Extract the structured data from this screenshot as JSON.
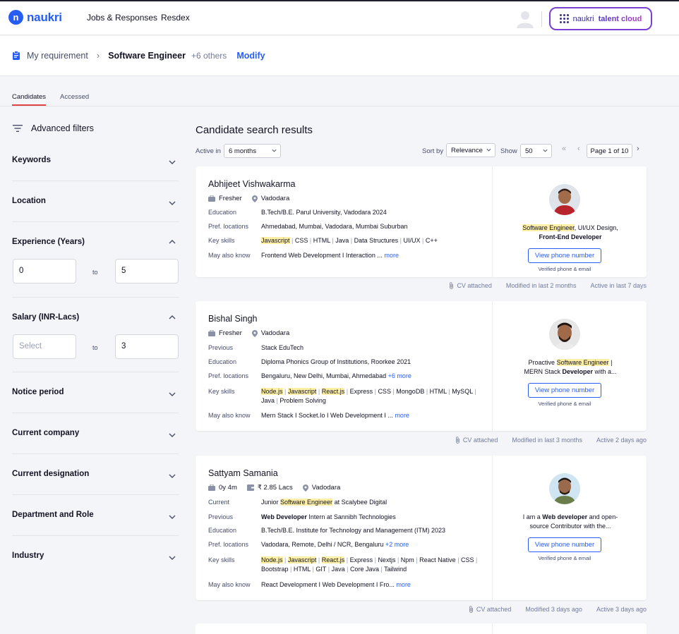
{
  "header": {
    "logo_text": "naukri",
    "nav": [
      "Jobs & Responses",
      "Resdex"
    ],
    "talent_cloud": {
      "prefix": "naukri",
      "brand": "talent cloud"
    }
  },
  "requirement": {
    "label": "My requirement",
    "title": "Software Engineer",
    "others": "+6 others",
    "modify": "Modify"
  },
  "tabs": [
    "Candidates",
    "Accessed"
  ],
  "filters": {
    "title": "Advanced filters",
    "sections": [
      "Keywords",
      "Location",
      "Experience (Years)",
      "Salary (INR-Lacs)",
      "Notice period",
      "Current company",
      "Current designation",
      "Department and Role",
      "Industry"
    ],
    "experience": {
      "min": "0",
      "to": "to",
      "max": "5"
    },
    "salary": {
      "min_placeholder": "Select",
      "to": "to",
      "max": "3"
    }
  },
  "results": {
    "title": "Candidate search results",
    "active_in_label": "Active in",
    "active_in_value": "6 months",
    "sort_by_label": "Sort by",
    "sort_by_value": "Relevance",
    "show_label": "Show",
    "show_value": "50",
    "page": "Page 1 of 10"
  },
  "candidates": [
    {
      "name": "Abhijeet Vishwakarma",
      "experience": "Fresher",
      "location": "Vadodara",
      "education_label": "Education",
      "education": "B.Tech/B.E. Parul University, Vadodara 2024",
      "pref_label": "Pref. locations",
      "pref_locations": "Ahmedabad, Mumbai, Vadodara, Mumbai Suburban",
      "skills_label": "Key skills",
      "skills": [
        "Javascript",
        "CSS",
        "HTML",
        "Java",
        "Data Structures",
        "UI/UX",
        "C++"
      ],
      "also_label": "May also know",
      "also_know": "Frontend Web Development I Interaction ...",
      "more": "more",
      "blurb_a": "Software Engineer",
      "blurb_b": ", UI/UX Design,",
      "blurb_c": "Front-End Developer",
      "view_phone": "View phone number",
      "verified": "Verified phone & email",
      "cv": "CV attached",
      "modified": "Modified in last 2 months",
      "active": "Active in last 7 days"
    },
    {
      "name": "Bishal Singh",
      "experience": "Fresher",
      "location": "Vadodara",
      "previous_label": "Previous",
      "previous": "Stack EduTech",
      "education_label": "Education",
      "education": "Diploma Phonics Group of Institutions, Roorkee 2021",
      "pref_label": "Pref. locations",
      "pref_locations": "Bengaluru, New Delhi, Mumbai, Ahmedabad",
      "pref_more": "+6 more",
      "skills_label": "Key skills",
      "skills": [
        "Node.js",
        "Javascript",
        "React.js",
        "Express",
        "CSS",
        "MongoDB",
        "HTML",
        "MySQL",
        "Java",
        "Problem Solving"
      ],
      "also_label": "May also know",
      "also_know": "Mern Stack I Socket.Io I Web Development I ...",
      "more": "more",
      "blurb_a": "Proactive ",
      "blurb_b": "Software Engineer",
      "blurb_c": " |",
      "blurb_d": "MERN Stack ",
      "blurb_e": "Developer",
      "blurb_f": " with a...",
      "view_phone": "View phone number",
      "verified": "Verified phone & email",
      "cv": "CV attached",
      "modified": "Modified in last 3 months",
      "active": "Active 2 days ago"
    },
    {
      "name": "Sattyam Samania",
      "experience": "0y 4m",
      "salary": "₹ 2.85 Lacs",
      "location": "Vadodara",
      "current_label": "Current",
      "current_a": "Junior ",
      "current_b": "Software Engineer",
      "current_c": " at Scalybee Digital",
      "previous_label": "Previous",
      "previous_a": "Web Developer",
      "previous_b": " Intern at Sannibh Technologies",
      "education_label": "Education",
      "education": "B.Tech/B.E. Institute for Technology and Management (ITM) 2023",
      "pref_label": "Pref. locations",
      "pref_locations": "Vadodara, Remote, Delhi / NCR, Bengaluru",
      "pref_more": "+2 more",
      "skills_label": "Key skills",
      "skills": [
        "Node.js",
        "Javascript",
        "React.js",
        "Express",
        "Nextjs",
        "Npm",
        "React Native",
        "CSS",
        "Bootstrap",
        "HTML",
        "GIT",
        "Java",
        "Core Java",
        "Tailwind"
      ],
      "also_label": "May also know",
      "also_know": "React Development I Web Development I Fro...",
      "more": "more",
      "blurb_a": "I am a ",
      "blurb_b": "Web developer",
      "blurb_c": " and open-",
      "blurb_d": "source Contributor with the...",
      "view_phone": "View phone number",
      "verified": "Verified phone & email",
      "cv": "CV attached",
      "modified": "Modified 3 days ago",
      "active": "Active 3 days ago"
    }
  ]
}
